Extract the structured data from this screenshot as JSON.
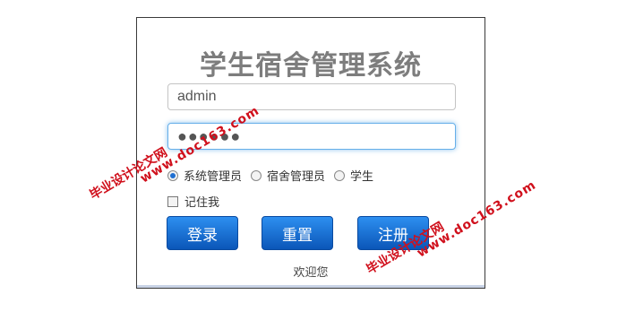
{
  "title": "学生宿舍管理系统",
  "username": {
    "value": "admin"
  },
  "password": {
    "value": "●●●●●●"
  },
  "roles": [
    {
      "label": "系统管理员",
      "checked": true
    },
    {
      "label": "宿舍管理员",
      "checked": false
    },
    {
      "label": "学生",
      "checked": false
    }
  ],
  "remember_label": "记住我",
  "buttons": {
    "login": "登录",
    "reset": "重置",
    "register": "注册"
  },
  "welcome": "欢迎您",
  "watermark": {
    "text": "毕业设计论文网",
    "url": "www.doc163.com"
  },
  "colors": {
    "button": "#1a72d9",
    "watermark": "#d0101c",
    "focus": "#66afe9"
  }
}
